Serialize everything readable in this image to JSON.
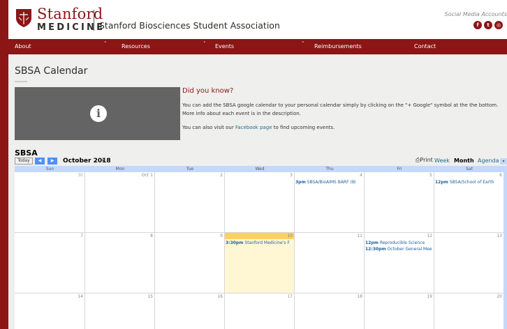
{
  "header": {
    "logo_wordmark": "Stanford",
    "logo_sub": "MEDICINE",
    "site_title": "Stanford Biosciences Student Association",
    "social_label": "Social Media Accounts",
    "social_icons": [
      "facebook-icon",
      "twitter-icon",
      "instagram-icon"
    ]
  },
  "nav": {
    "items": [
      {
        "label": "About",
        "has_dropdown": true
      },
      {
        "label": "Resources",
        "has_dropdown": true
      },
      {
        "label": "Events",
        "has_dropdown": true
      },
      {
        "label": "Reimbursements",
        "has_dropdown": true
      },
      {
        "label": "Contact",
        "has_dropdown": false
      }
    ],
    "chevron": "˅"
  },
  "page": {
    "title": "SBSA Calendar",
    "info_glyph": "i",
    "dyk_heading": "Did you know?",
    "dyk_line1": "You can add the SBSA google calendar to your personal calendar simply by clicking on the \"+ Google\" symbol at the the bottom.",
    "dyk_line2": "More info about each event is in the description.",
    "dyk_line3_pre": "You can also visit our ",
    "dyk_line3_link": "Facebook page",
    "dyk_line3_post": " to find upcoming events."
  },
  "calendar": {
    "title": "SBSA",
    "today_label": "Today",
    "prev_label": "◀",
    "next_label": "▶",
    "month_label": "October 2018",
    "month_dropdown": "▾",
    "print_label": "Print",
    "views": [
      "Week",
      "Month",
      "Agenda"
    ],
    "active_view": "Month",
    "agenda_dropdown": "▾",
    "days_of_week": [
      "Sun",
      "Mon",
      "Tue",
      "Wed",
      "Thu",
      "Fri",
      "Sat"
    ],
    "weeks": [
      [
        {
          "num": "30",
          "other": true,
          "events": []
        },
        {
          "num": "Oct 1",
          "events": []
        },
        {
          "num": "2",
          "events": []
        },
        {
          "num": "3",
          "events": []
        },
        {
          "num": "4",
          "events": [
            {
              "time": "3pm",
              "title": "SBSA/BioAIMS BARF (Bi"
            }
          ]
        },
        {
          "num": "5",
          "events": []
        },
        {
          "num": "6",
          "events": [
            {
              "time": "12pm",
              "title": "SBSA/School of Earth"
            }
          ]
        }
      ],
      [
        {
          "num": "7",
          "events": []
        },
        {
          "num": "8",
          "events": []
        },
        {
          "num": "9",
          "events": []
        },
        {
          "num": "10",
          "today": true,
          "events": [
            {
              "time": "3:30pm",
              "title": "Stanford Medicine's F"
            }
          ]
        },
        {
          "num": "11",
          "events": []
        },
        {
          "num": "12",
          "events": [
            {
              "time": "12pm",
              "title": "Reproducible Science"
            },
            {
              "time": "12:30pm",
              "title": "October General Mee"
            }
          ]
        },
        {
          "num": "13",
          "events": []
        }
      ],
      [
        {
          "num": "14",
          "events": []
        },
        {
          "num": "15",
          "events": []
        },
        {
          "num": "16",
          "events": []
        },
        {
          "num": "17",
          "events": []
        },
        {
          "num": "18",
          "events": []
        },
        {
          "num": "19",
          "events": []
        },
        {
          "num": "20",
          "events": []
        }
      ]
    ]
  }
}
